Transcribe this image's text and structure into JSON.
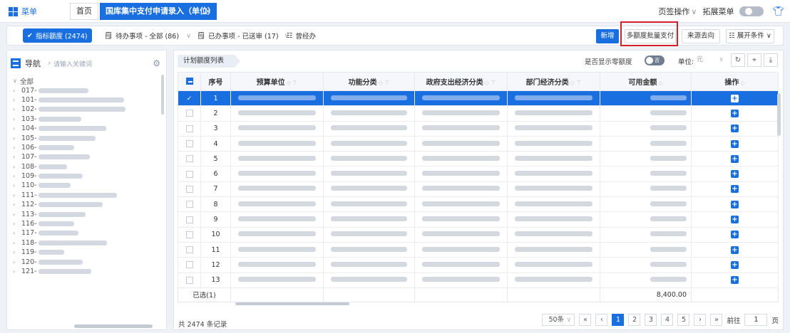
{
  "topbar": {
    "menu_label": "菜单",
    "tabs": [
      {
        "label": "首页"
      },
      {
        "label": "国库集中支付申请录入（单位）",
        "close": "×"
      }
    ],
    "page_ops": "页签操作",
    "ext_menu": "拓展菜单",
    "chevron": "∨"
  },
  "toolbar": {
    "filters": [
      {
        "label": "指标额度 (2474)",
        "active": true
      },
      {
        "label": "待办事项 - 全部 (86)"
      },
      {
        "label": "已办事项 - 已送审 (17)"
      },
      {
        "label": "曾经办"
      }
    ],
    "buttons": {
      "add": "新增",
      "batch_pay": "多额度批量支付",
      "source": "来源去向",
      "expand": "展开条件"
    }
  },
  "sidebar": {
    "nav_label": "导航",
    "search_placeholder": "请输入关键词",
    "root": "全部",
    "items": [
      {
        "code": "017-",
        "w": 70
      },
      {
        "code": "101-",
        "w": 120
      },
      {
        "code": "102-",
        "w": 122
      },
      {
        "code": "103-",
        "w": 60
      },
      {
        "code": "104-",
        "w": 95
      },
      {
        "code": "105-",
        "w": 80
      },
      {
        "code": "106-",
        "w": 50
      },
      {
        "code": "107-",
        "w": 72
      },
      {
        "code": "108-",
        "w": 40
      },
      {
        "code": "109-",
        "w": 62
      },
      {
        "code": "110-",
        "w": 45
      },
      {
        "code": "111-",
        "w": 110
      },
      {
        "code": "112-",
        "w": 90
      },
      {
        "code": "113-",
        "w": 66
      },
      {
        "code": "116-",
        "w": 50
      },
      {
        "code": "117-",
        "w": 56
      },
      {
        "code": "118-",
        "w": 96
      },
      {
        "code": "119-",
        "w": 36
      },
      {
        "code": "120-",
        "w": 62
      },
      {
        "code": "121-",
        "w": 74
      }
    ]
  },
  "main": {
    "list_title": "计划额度列表",
    "show_zero_label": "是否显示零额度",
    "toggle_text": "否",
    "unit_label": "单位:",
    "unit_value": "元",
    "columns": [
      "序号",
      "预算单位",
      "功能分类",
      "政府支出经济分类",
      "部门经济分类",
      "可用金额",
      "操作"
    ],
    "rows": [
      1,
      2,
      3,
      4,
      5,
      6,
      7,
      8,
      9,
      10,
      11,
      12,
      13
    ],
    "selected_row": 1,
    "footer": {
      "selected_label": "已选(1)",
      "sum": "8,400.00"
    },
    "total_text": "共 2474 条记录",
    "pagination": {
      "page_size": "50条",
      "pages": [
        "1",
        "2",
        "3",
        "4",
        "5"
      ],
      "current": "1",
      "goto_label": "前往",
      "goto_value": "1",
      "page_suffix": "页"
    }
  },
  "colors": {
    "primary": "#1a6fe0",
    "highlight": "#d5202b"
  }
}
